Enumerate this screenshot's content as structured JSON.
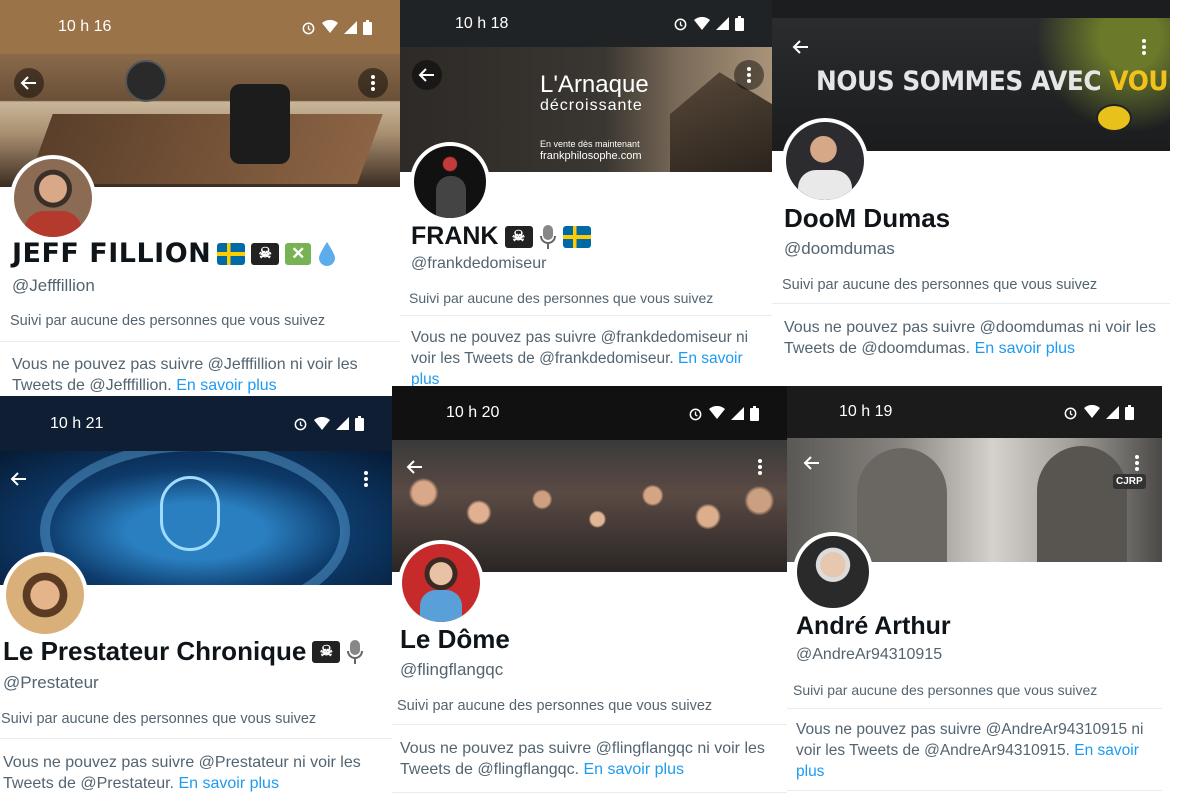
{
  "colors": {
    "link": "#1d9bf0",
    "muted": "#536471",
    "text": "#0f1419"
  },
  "icons": {
    "back": "arrow-left-icon",
    "more": "more-vertical-icon",
    "alarm": "alarm-icon",
    "wifi": "wifi-icon",
    "signal": "signal-icon",
    "battery": "battery-icon"
  },
  "profiles": [
    {
      "time": "10 h 16",
      "name": "JEFF FILLION",
      "emojis": [
        "flag-sweden-icon",
        "pirate-flag-icon",
        "cross-mark-icon",
        "droplet-icon"
      ],
      "handle": "@Jefffillion",
      "followed": "Suivi par aucune des personnes que vous suivez",
      "msg": "Vous ne pouvez pas suivre @Jefffillion ni voir les Tweets de @Jefffillion.",
      "link": "En savoir plus"
    },
    {
      "time": "10 h 18",
      "banner_title": "L'Arnaque",
      "banner_subtitle": "décroissante",
      "banner_line1": "En vente dès maintenant",
      "banner_line2": "frankphilosophe.com",
      "name": "FRANK",
      "emojis": [
        "pirate-flag-icon",
        "microphone-icon",
        "flag-sweden-icon"
      ],
      "handle": "@frankdedomiseur",
      "followed": "Suivi par aucune des personnes que vous suivez",
      "msg": "Vous ne pouvez pas suivre @frankdedomiseur ni voir les Tweets de @frankdedomiseur.",
      "link": "En savoir plus"
    },
    {
      "banner_text_a": "NOUS SOMMES AVEC ",
      "banner_text_b": "VOUS",
      "name": "DooM Dumas",
      "emojis": [],
      "handle": "@doomdumas",
      "followed": "Suivi par aucune des personnes que vous suivez",
      "msg": "Vous ne pouvez pas suivre @doomdumas ni voir les Tweets de @doomdumas.",
      "link": "En savoir plus"
    },
    {
      "time": "10 h 21",
      "name": "Le Prestateur Chronique",
      "emojis": [
        "pirate-flag-icon",
        "microphone-icon"
      ],
      "handle": "@Prestateur",
      "followed": "Suivi par aucune des personnes que vous suivez",
      "msg": "Vous ne pouvez pas suivre @Prestateur ni voir les Tweets de @Prestateur.",
      "link": "En savoir plus"
    },
    {
      "time": "10 h 20",
      "name": "Le Dôme",
      "emojis": [],
      "handle": "@flingflangqc",
      "followed": "Suivi par aucune des personnes que vous suivez",
      "msg": "Vous ne pouvez pas suivre @flingflangqc ni voir les Tweets de @flingflangqc.",
      "link": "En savoir plus"
    },
    {
      "time": "10 h 19",
      "banner_badge": "CJRP",
      "name": "André Arthur",
      "emojis": [],
      "handle": "@AndreAr94310915",
      "followed": "Suivi par aucune des personnes que vous suivez",
      "msg": "Vous ne pouvez pas suivre @AndreAr94310915 ni voir les Tweets de @AndreAr94310915.",
      "link": "En savoir plus"
    }
  ]
}
